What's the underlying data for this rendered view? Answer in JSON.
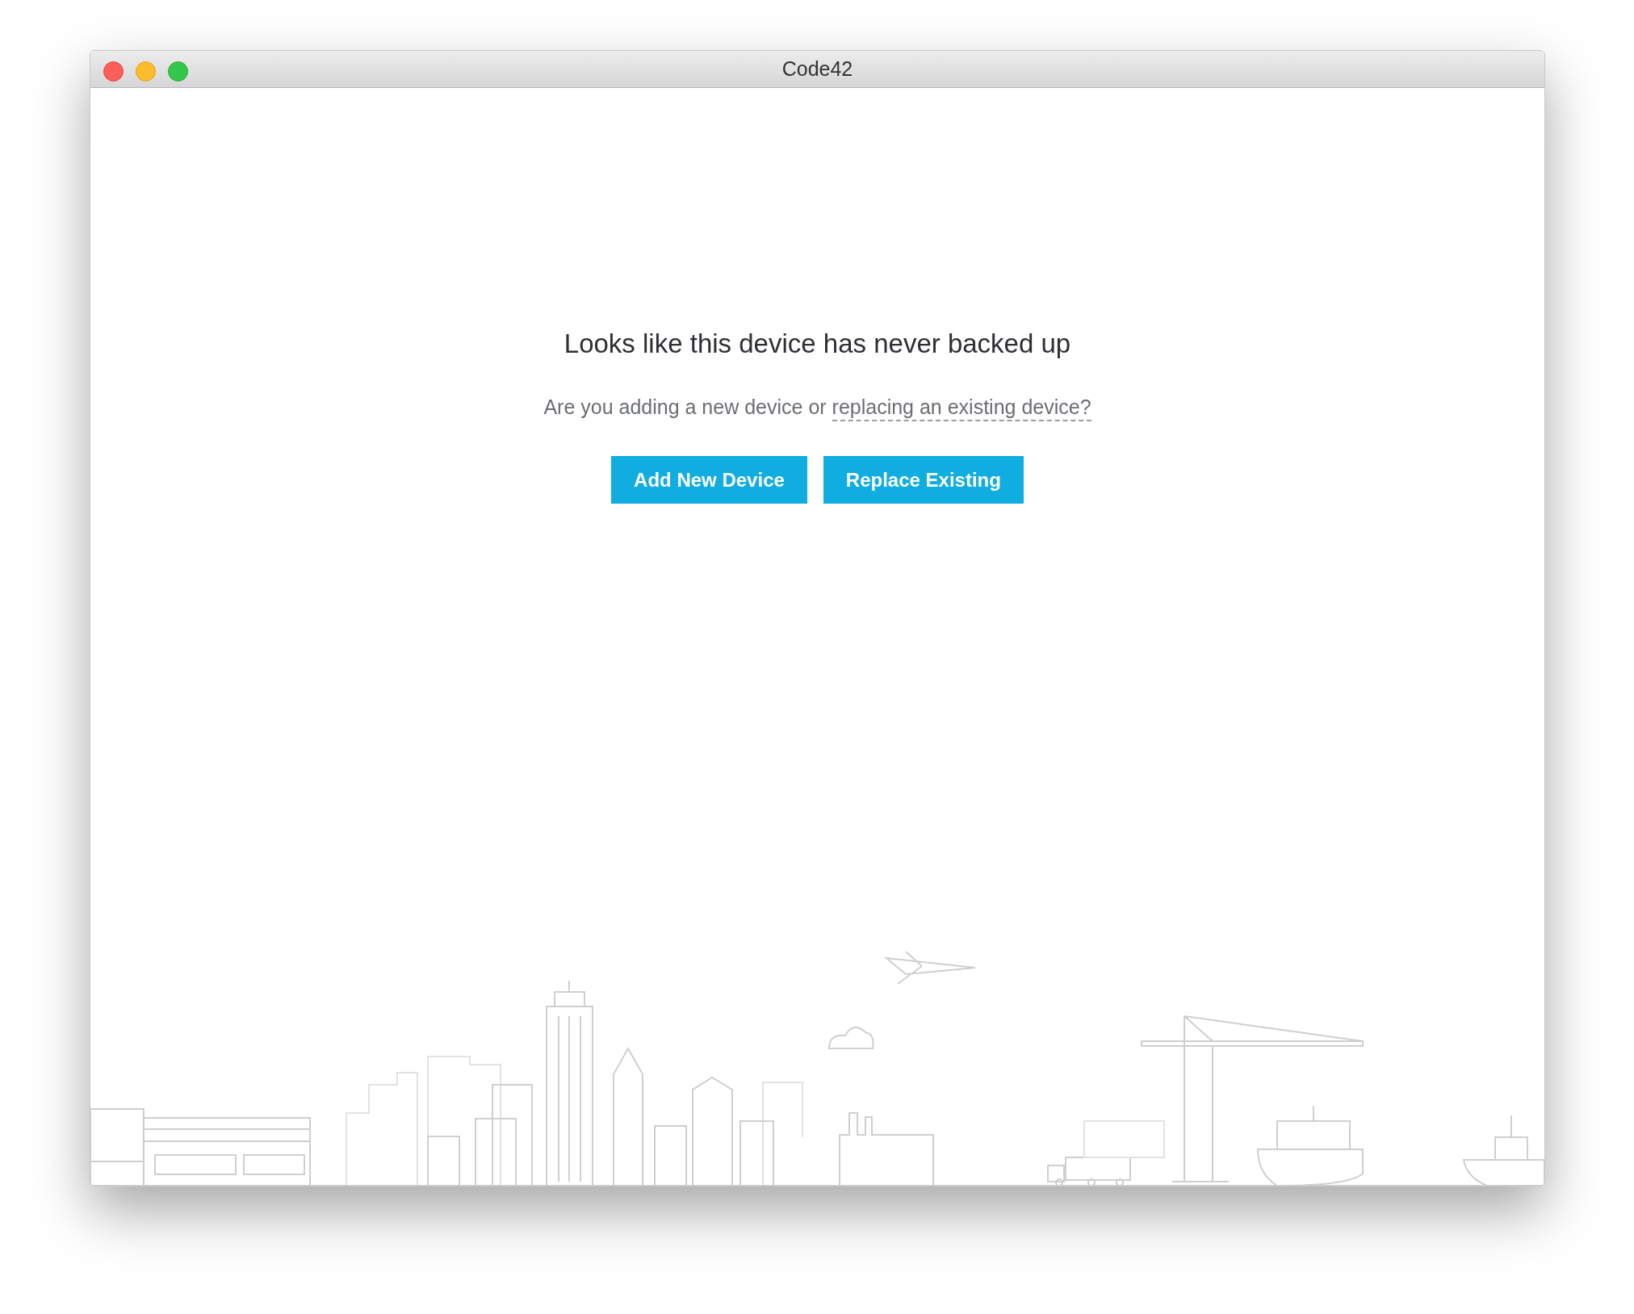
{
  "window": {
    "title": "Code42"
  },
  "heading": "Looks like this device has never backed up",
  "prompt": {
    "text": "Are you adding a new device or",
    "link": "replacing an existing device?"
  },
  "buttons": [
    {
      "label": "Add New Device"
    },
    {
      "label": "Replace Existing"
    }
  ]
}
